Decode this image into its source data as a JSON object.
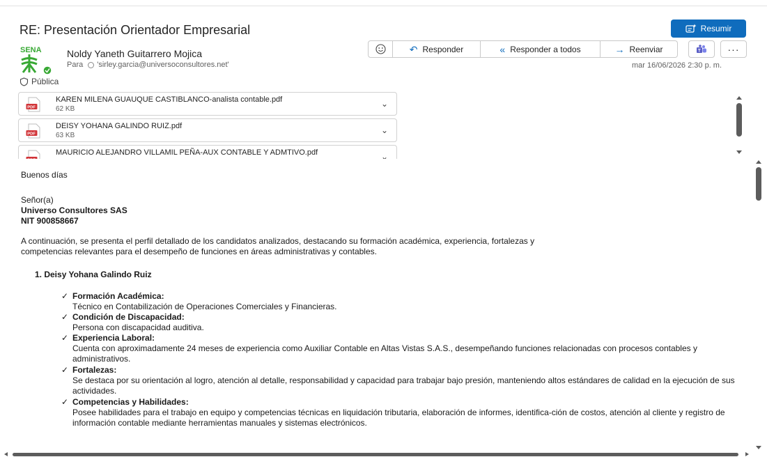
{
  "email": {
    "subject": "RE: Presentación Orientador Empresarial",
    "summarize_label": "Resumir",
    "sender": "Noldy Yaneth Guitarrero Mojica",
    "to_label": "Para",
    "to_address": "'sirley.garcia@universoconsultores.net'",
    "date": "mar 16/06/2026 2:30 p. m.",
    "sensitivity": "Pública",
    "logo_text": "SENA"
  },
  "actions": {
    "reply": "Responder",
    "reply_all": "Responder a todos",
    "forward": "Reenviar"
  },
  "attachments": [
    {
      "name": "KAREN MILENA GUAUQUE CASTIBLANCO-analista contable.pdf",
      "size": "62 KB",
      "icon": "PDF"
    },
    {
      "name": "DEISY YOHANA  GALINDO RUIZ.pdf",
      "size": "63 KB",
      "icon": "PDF"
    },
    {
      "name": "MAURICIO ALEJANDRO VILLAMIL PEÑA-AUX CONTABLE Y ADMTIVO.pdf",
      "size": "",
      "icon": "PDF"
    }
  ],
  "body": {
    "greeting": "Buenos días",
    "salutation": "Señor(a)",
    "company": "Universo Consultores SAS",
    "nit": "NIT 900858667",
    "intro_1": "A continuación, se presenta el perfil detallado de los candidatos analizados, destacando su formación académica, experiencia, fortalezas y",
    "intro_2": "competencias relevantes para el desempeño de funciones en áreas administrativas y contables.",
    "candidate_1_title": "1.   Deisy Yohana Galindo Ruiz",
    "sections": [
      {
        "label": "Formación Académica:",
        "text": "Técnico en Contabilización de Operaciones Comerciales y Financieras."
      },
      {
        "label": "Condición de Discapacidad:",
        "text": "Persona con discapacidad auditiva."
      },
      {
        "label": "Experiencia Laboral:",
        "text": "Cuenta con aproximadamente 24 meses de experiencia como Auxiliar Contable en Altas Vistas S.A.S., desempeñando funciones relacionadas con procesos contables y administrativos."
      },
      {
        "label": "Fortalezas:",
        "text": "Se destaca por su orientación al logro, atención al detalle, responsabilidad y capacidad para trabajar bajo presión, manteniendo altos estándares de calidad en la ejecución de sus actividades."
      },
      {
        "label": "Competencias y Habilidades:",
        "text": "Posee habilidades para el trabajo en equipo y competencias técnicas en liquidación tributaria, elaboración de informes, identifica-ción de costos, atención al cliente y registro de información contable mediante herramientas manuales y sistemas electrónicos."
      }
    ]
  },
  "colors": {
    "accent": "#0f6cbd",
    "sena_green": "#39a935",
    "pdf_red": "#d13438"
  },
  "icons": [
    "summarize-icon",
    "emoji-icon",
    "reply-arrow-icon",
    "reply-all-arrow-icon",
    "forward-arrow-icon",
    "teams-icon",
    "more-icon",
    "shield-icon",
    "pdf-icon",
    "chevron-down-icon",
    "checkmark-icon"
  ]
}
